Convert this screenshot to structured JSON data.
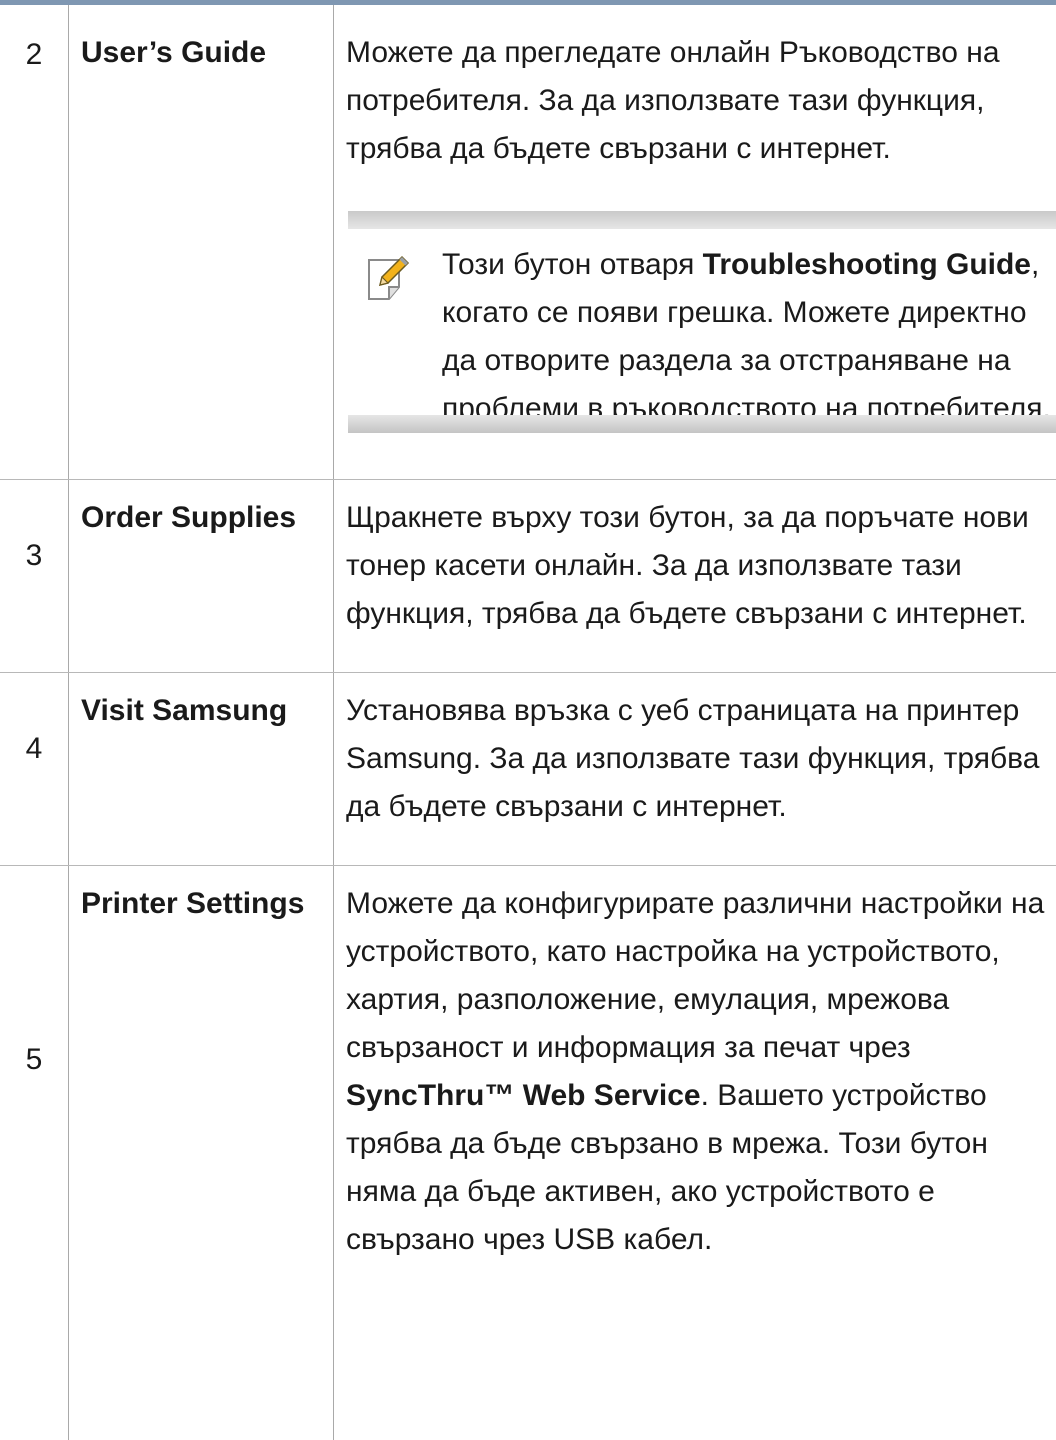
{
  "rows": [
    {
      "num": "2",
      "name": "User’s Guide",
      "desc": "Можете да прегледате онлайн Ръководство на потребителя. За да използвате тази функция, трябва да бъдете свързани с интернет.",
      "note": {
        "prefix": "Този бутон отваря ",
        "bold": "Troubleshooting Guide",
        "suffix": ", когато се появи грешка. Можете директно да отворите раздела за отстраняване на проблеми в ръководството на потребителя."
      }
    },
    {
      "num": "3",
      "name": "Order Supplies",
      "desc": "Щракнете върху този бутон, за да поръчате нови тонер касети онлайн. За да използвате тази функция, трябва да бъдете свързани с интернет."
    },
    {
      "num": "4",
      "name": "Visit Samsung",
      "desc": "Установява връзка с уеб страницата на принтер Samsung. За да използвате тази функция, трябва да бъдете свързани с интернет."
    },
    {
      "num": "5",
      "name": "Printer Settings",
      "desc_prefix": "Можете да конфигурирате различни настройки на устройството, като настройка на устройството, хартия, разположение, емулация, мрежова свързаност и информация за печат чрез ",
      "desc_bold": "SyncThru™ Web Service",
      "desc_suffix": ". Вашето устройство трябва да бъде свързано в мрежа. Този бутон няма да бъде активен, ако устройството е свързано чрез USB кабел."
    }
  ],
  "colors": {
    "top_rule": "#7f97b2",
    "grid_line": "#b8b8b8",
    "note_bar": "#d0d0d0"
  },
  "icons": {
    "note": "note-pencil-icon"
  }
}
